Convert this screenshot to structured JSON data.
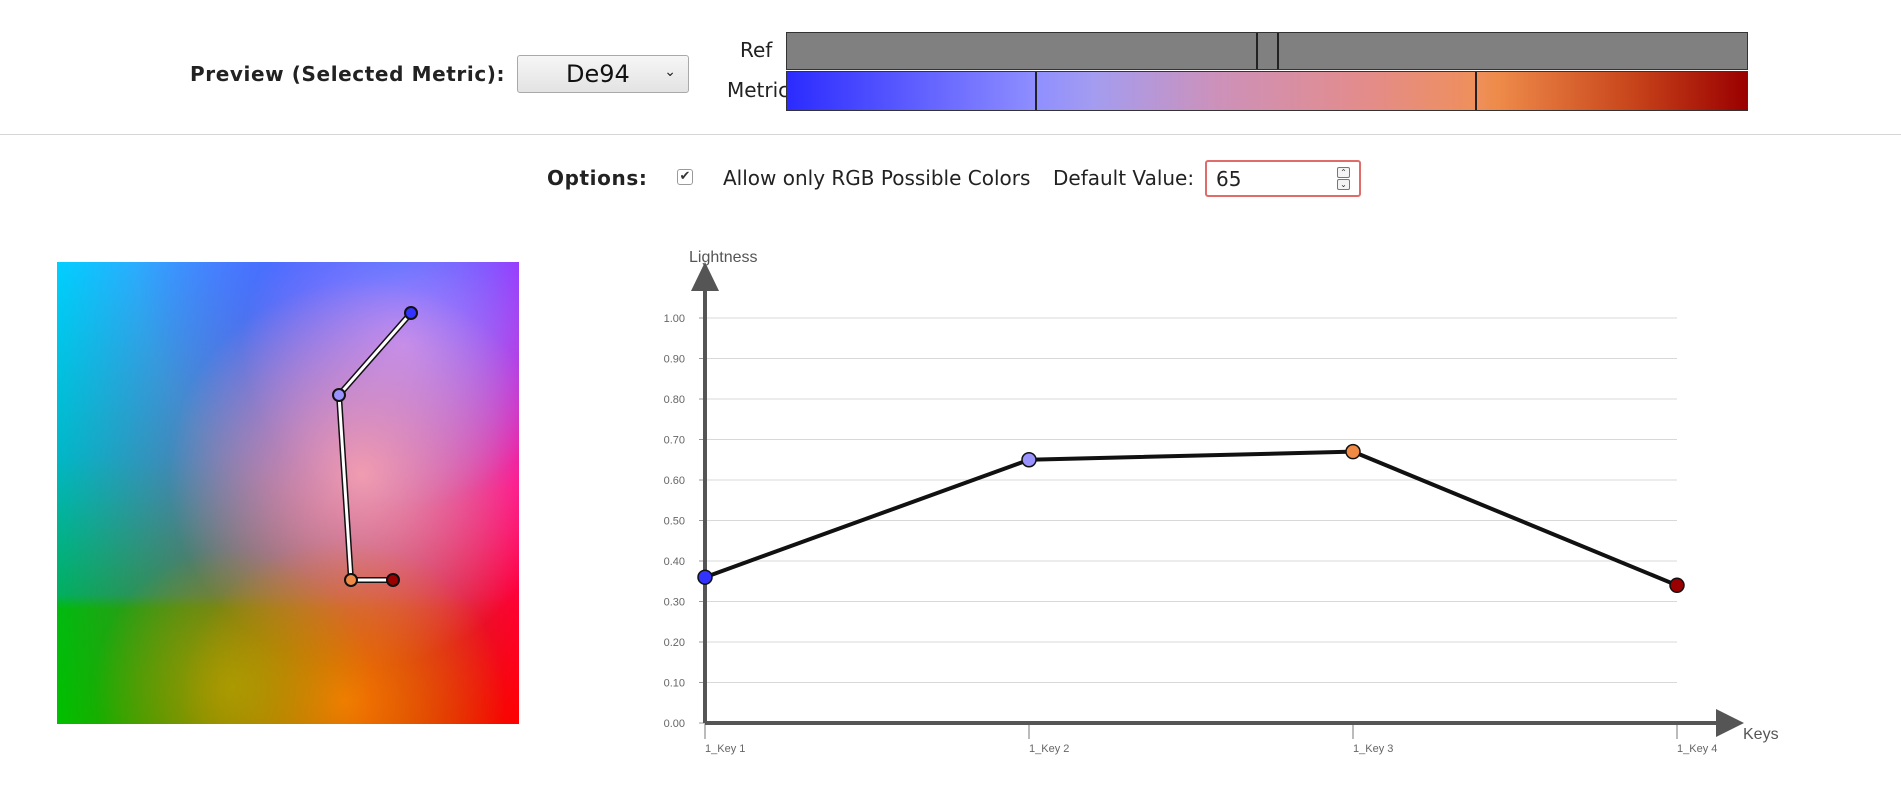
{
  "preview": {
    "label": "Preview (Selected Metric):",
    "selected_metric": "De94",
    "ref_label": "Ref",
    "metric_label": "Metric"
  },
  "options": {
    "label": "Options:",
    "rgb_only_checked": true,
    "rgb_only_label": "Allow only RGB Possible Colors",
    "default_value_label": "Default Value:",
    "default_value": "65"
  },
  "color_plane": {
    "path_colors": [
      "#3333ff",
      "#9a92ff",
      "#ee8a45",
      "#9b0000"
    ]
  },
  "chart_data": {
    "type": "line",
    "ylabel": "Lightness",
    "xlabel": "Keys",
    "categories": [
      "1_Key 1",
      "1_Key 2",
      "1_Key 3",
      "1_Key 4"
    ],
    "values": [
      0.36,
      0.65,
      0.67,
      0.34
    ],
    "point_colors": [
      "#3333ff",
      "#9a92ff",
      "#ee8a45",
      "#9b0000"
    ],
    "ylim": [
      0,
      1
    ],
    "yticks": [
      "0.00",
      "0.10",
      "0.20",
      "0.30",
      "0.40",
      "0.50",
      "0.60",
      "0.70",
      "0.80",
      "0.90",
      "1.00"
    ],
    "grid": true
  }
}
